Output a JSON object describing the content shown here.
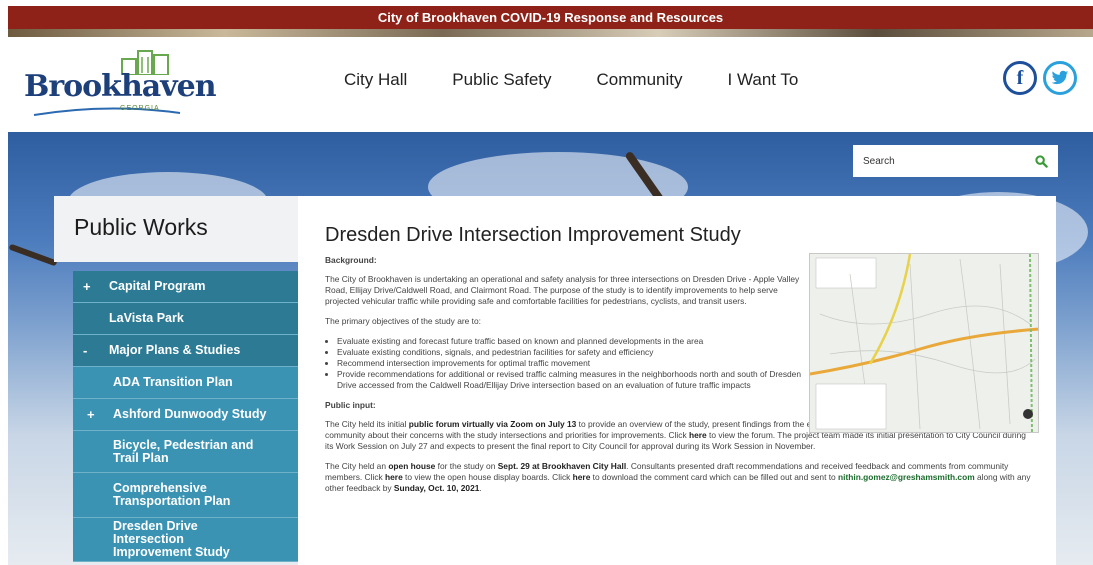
{
  "alert": {
    "text": "City of Brookhaven COVID-19 Response and Resources"
  },
  "logo": {
    "name": "Brookhaven",
    "sub": "GEORGIA"
  },
  "nav": [
    "City Hall",
    "Public Safety",
    "Community",
    "I Want To"
  ],
  "social": {
    "facebook": "f",
    "twitter": "twitter"
  },
  "search": {
    "placeholder": "Search"
  },
  "sidebar": {
    "title": "Public Works",
    "items": [
      {
        "toggle": "+",
        "label": "Capital Program",
        "level": 1
      },
      {
        "toggle": "",
        "label": "LaVista Park",
        "level": 1
      },
      {
        "toggle": "-",
        "label": "Major Plans & Studies",
        "level": 1
      },
      {
        "toggle": "",
        "label": "ADA Transition Plan",
        "level": 2
      },
      {
        "toggle": "+",
        "label": "Ashford Dunwoody Study",
        "level": 2
      },
      {
        "toggle": "",
        "label": "Bicycle, Pedestrian and Trail Plan",
        "level": 2
      },
      {
        "toggle": "",
        "label": "Comprehensive Transportation Plan",
        "level": 2
      },
      {
        "toggle": "",
        "label": "Dresden Drive Intersection Improvement Study",
        "level": 2
      }
    ]
  },
  "main": {
    "title": "Dresden Drive Intersection Improvement Study",
    "background_head": "Background:",
    "background_text": "The City of Brookhaven is undertaking an operational and safety analysis for three intersections on Dresden Drive - Apple Valley Road, Ellijay Drive/Caldwell Road, and Clairmont Road. The purpose of the study is to identify improvements to help serve projected vehicular traffic while providing safe and comfortable facilities for pedestrians, cyclists, and transit users.",
    "objectives_intro": "The primary objectives of the study are to:",
    "objectives": [
      "Evaluate existing and forecast future traffic based on known and planned developments in the area",
      "Evaluate existing conditions, signals, and pedestrian facilities for safety and efficiency",
      "Recommend intersection improvements for optimal traffic movement",
      "Provide recommendations for additional or revised traffic calming measures in the neighborhoods north and south of Dresden Drive accessed from the Caldwell Road/Ellijay Drive intersection based on an evaluation of future traffic impacts"
    ],
    "public_head": "Public input:",
    "p1_a": "The City held its initial ",
    "p1_b": "public forum virtually via Zoom on July 13",
    "p1_c": " to provide an overview of the study, present findings from the existing conditions analysis, and solicit input from the community about their concerns with the study intersections and priorities for improvements. Click ",
    "p1_d": "here",
    "p1_e": " to view the forum. The project team made its initial presentation to City Council during its Work Session on July 27 and expects to present the final report to City Council for approval during its Work Session in November.",
    "p2_a": "The City held an ",
    "p2_b": "open house",
    "p2_c": " for the study on ",
    "p2_d": "Sept. 29 at Brookhaven City Hall",
    "p2_e": ". Consultants presented draft recommendations and received feedback and comments from community members. Click ",
    "p2_f": "here",
    "p2_g": " to view the open house display boards. Click ",
    "p2_h": "here",
    "p2_i": " to download the comment card which can be filled out and sent to ",
    "p2_email": "nithin.gomez@greshamsmith.com",
    "p2_j": " along with any other feedback by ",
    "p2_k": "Sunday, Oct. 10, 2021",
    "p2_l": "."
  },
  "map": {
    "alt": "study area map"
  },
  "colors": {
    "alert": "#8e2218",
    "sidebar_level1": "#2d7a95",
    "sidebar_level2": "#3b93b3",
    "brand_blue": "#1d3f7a",
    "search_icon": "#3a9a36"
  }
}
